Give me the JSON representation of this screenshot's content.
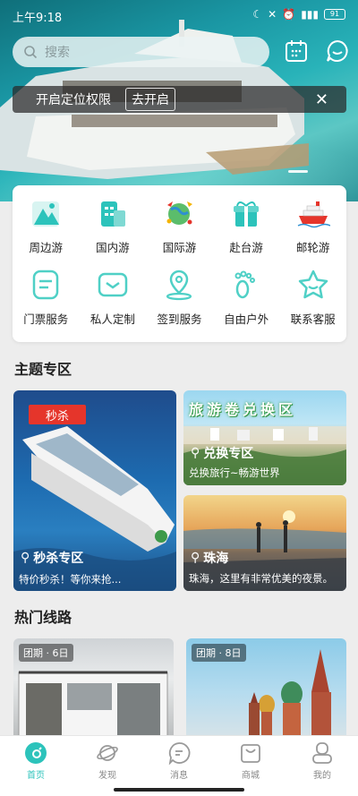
{
  "status": {
    "time": "上午9:18",
    "battery": "91"
  },
  "search": {
    "placeholder": "搜索"
  },
  "location_banner": {
    "text": "开启定位权限",
    "action": "去开启",
    "close": "✕"
  },
  "quick_menu": [
    {
      "label": "周边游",
      "icon": "mountain-icon"
    },
    {
      "label": "国内游",
      "icon": "building-icon"
    },
    {
      "label": "国际游",
      "icon": "globe-icon"
    },
    {
      "label": "赴台游",
      "icon": "gift-icon"
    },
    {
      "label": "邮轮游",
      "icon": "cruise-ship-icon"
    },
    {
      "label": "门票服务",
      "icon": "ticket-icon"
    },
    {
      "label": "私人定制",
      "icon": "custom-icon"
    },
    {
      "label": "签到服务",
      "icon": "checkin-icon"
    },
    {
      "label": "自由户外",
      "icon": "footprint-icon"
    },
    {
      "label": "联系客服",
      "icon": "service-star-icon"
    }
  ],
  "themes": {
    "title": "主题专区",
    "flash": {
      "tag": "秒杀",
      "title": "秒杀专区",
      "subtitle": "特价秒杀！等你来抢..."
    },
    "exchange": {
      "banner": "旅游卷兑换区",
      "title": "兑换专区",
      "subtitle": "兑换旅行~畅游世界"
    },
    "zhuhai": {
      "title": "珠海",
      "subtitle": "珠海，这里有非常优美的夜景。"
    }
  },
  "hot_routes": {
    "title": "热门线路",
    "items": [
      {
        "badge": "团期 · 6日"
      },
      {
        "badge": "团期 · 8日"
      }
    ]
  },
  "tabs": [
    {
      "label": "首页",
      "icon": "home-icon"
    },
    {
      "label": "发现",
      "icon": "planet-icon"
    },
    {
      "label": "消息",
      "icon": "message-icon"
    },
    {
      "label": "商城",
      "icon": "shop-bag-icon"
    },
    {
      "label": "我的",
      "icon": "profile-icon"
    }
  ],
  "colors": {
    "accent": "#2cc3bb",
    "red_tag": "#e5352b"
  }
}
